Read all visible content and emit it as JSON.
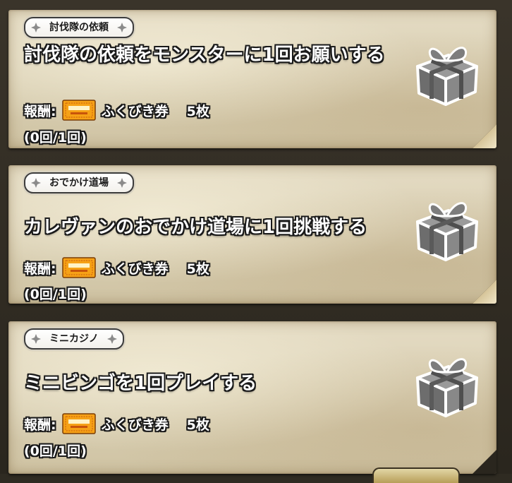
{
  "quests": [
    {
      "category": "討伐隊の依頼",
      "title": "討伐隊の依頼をモンスターに1回お願いする",
      "reward_label": "報酬:",
      "reward_icon": "ticket-icon",
      "reward_name": "ふくびき券",
      "reward_count": "5枚",
      "progress": "(0回/1回)",
      "completion_icon": "gift-box-icon"
    },
    {
      "category": "おでかけ道場",
      "title": "カレヴァンのおでかけ道場に1回挑戦する",
      "reward_label": "報酬:",
      "reward_icon": "ticket-icon",
      "reward_name": "ふくびき券",
      "reward_count": "5枚",
      "progress": "(0回/1回)",
      "completion_icon": "gift-box-icon"
    },
    {
      "category": "ミニカジノ",
      "title": "ミニビンゴを1回プレイする",
      "reward_label": "報酬:",
      "reward_icon": "ticket-icon",
      "reward_name": "ふくびき券",
      "reward_count": "5枚",
      "progress": "(0回/1回)",
      "completion_icon": "gift-box-icon"
    }
  ],
  "colors": {
    "parchment": "#ddd3b8",
    "text_fill": "#ffffff",
    "text_outline": "#1a1a1a",
    "ticket": "#f2a21a",
    "gift": "#7b7b7b"
  }
}
